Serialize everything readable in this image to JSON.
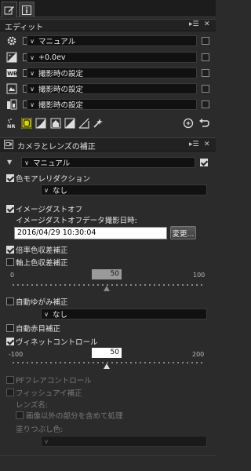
{
  "tabs": [
    {
      "name": "edit-tab",
      "icon": "edit-icon"
    },
    {
      "name": "info-tab",
      "icon": "info-icon"
    }
  ],
  "edit_panel": {
    "title": "エディット",
    "header_controls": {
      "menu": "▸☰",
      "close": "✕"
    },
    "rows": [
      {
        "icon": "gear-icon",
        "value": "マニュアル"
      },
      {
        "icon": "exposure-icon",
        "value": "+0.0ev"
      },
      {
        "icon": "wb-icon",
        "icon_text": "WB",
        "value": "撮影時の設定"
      },
      {
        "icon": "picture-control-icon",
        "value": "撮影時の設定"
      },
      {
        "icon": "active-dlighting-icon",
        "value": "撮影時の設定"
      }
    ],
    "toolbar": [
      "nr-icon",
      "lens-correction-icon",
      "tone-curve-icon",
      "color-booster-icon",
      "levels-icon",
      "straighten-icon",
      "retouch-brush-icon"
    ],
    "toolbar_right": [
      "history-icon",
      "undo-icon"
    ],
    "toolbar_nr_text": "NR"
  },
  "lens_panel": {
    "title": "カメラとレンズの補正",
    "header_controls": {
      "menu": "▸☰",
      "close": "✕"
    },
    "preset": "マニュアル",
    "color_moire": {
      "label": "色モアレリダクション",
      "checked": true,
      "value": "なし"
    },
    "dust_off": {
      "label": "イメージダストオフ",
      "checked": true,
      "date_label": "イメージダストオフデータ撮影日時:",
      "date_value": "2016/04/29 10:30:04",
      "change_button": "変更..."
    },
    "lateral_ca": {
      "label": "倍率色収差補正",
      "checked": true
    },
    "axial_ca": {
      "label": "軸上色収差補正",
      "checked": false,
      "value": "50",
      "min": "0",
      "max": "100",
      "level": 50
    },
    "distortion": {
      "label": "自動ゆがみ補正",
      "checked": false,
      "value": "なし"
    },
    "red_eye": {
      "label": "自動赤目補正",
      "checked": false
    },
    "vignette": {
      "label": "ヴィネットコントロール",
      "checked": true,
      "value": "50",
      "min": "-100",
      "max": "200",
      "level": 50
    },
    "pf_flare": {
      "label": "PFフレアコントロール",
      "checked": false
    },
    "fisheye": {
      "label": "フィッシュアイ補正",
      "checked": false,
      "lens_label": "レンズ名:",
      "include_outside": "画像以外の部分を含めて処理",
      "fill_color_label": "塗りつぶし色:"
    }
  }
}
